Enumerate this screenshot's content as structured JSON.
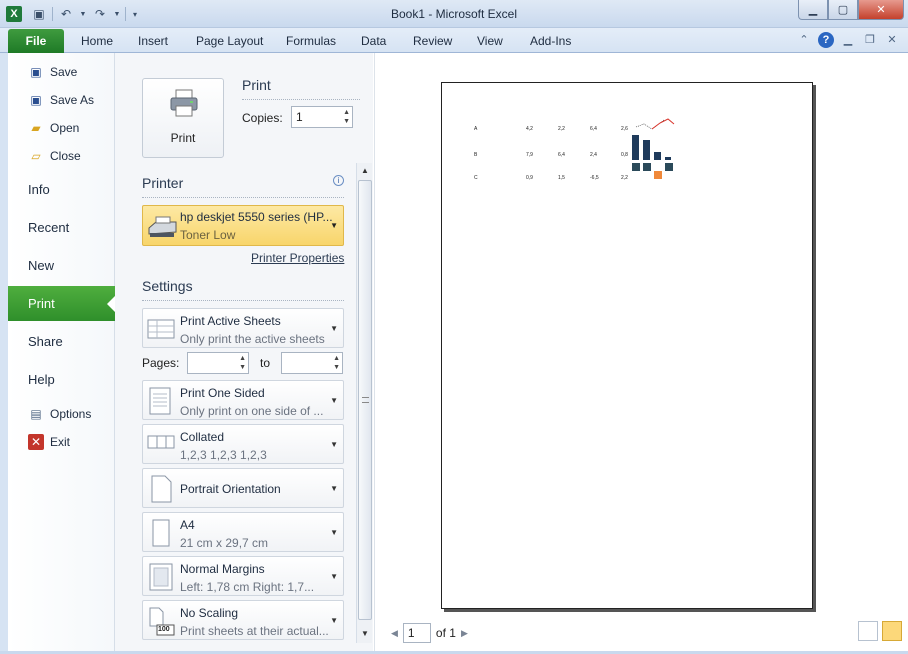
{
  "window": {
    "title": "Book1  -  Microsoft Excel",
    "app_letter": "X"
  },
  "ribbon": {
    "file_tab": "File",
    "tabs": [
      "Home",
      "Insert",
      "Page Layout",
      "Formulas",
      "Data",
      "Review",
      "View",
      "Add-Ins"
    ]
  },
  "nav": {
    "commands": [
      "Save",
      "Save As",
      "Open",
      "Close"
    ],
    "categories": [
      "Info",
      "Recent",
      "New",
      "Print",
      "Share",
      "Help"
    ],
    "bottom_commands": [
      "Options",
      "Exit"
    ]
  },
  "print_panel": {
    "heading": "Print",
    "button_label": "Print",
    "copies_label": "Copies:",
    "copies_value": "1",
    "printer_heading": "Printer",
    "printer_name": "hp deskjet 5550 series (HP...",
    "printer_status": "Toner Low",
    "printer_properties": "Printer Properties",
    "settings_heading": "Settings",
    "pages_label": "Pages:",
    "to_label": "to",
    "settings": [
      {
        "main": "Print Active Sheets",
        "sub": "Only print the active sheets"
      },
      {
        "main": "Print One Sided",
        "sub": "Only print on one side of ..."
      },
      {
        "main": "Collated",
        "sub": "1,2,3    1,2,3    1,2,3"
      },
      {
        "main": "Portrait Orientation",
        "sub": ""
      },
      {
        "main": "A4",
        "sub": "21 cm x 29,7 cm"
      },
      {
        "main": "Normal Margins",
        "sub": "Left:  1,78 cm    Right:  1,7..."
      },
      {
        "main": "No Scaling",
        "sub": "Print sheets at their actual..."
      }
    ],
    "scaling_badge": "100"
  },
  "preview": {
    "page_number": "1",
    "of_label": "of 1",
    "rows": [
      {
        "label": "A",
        "values": [
          "4,2",
          "2,2",
          "6,4",
          "2,6"
        ]
      },
      {
        "label": "B",
        "values": [
          "7,9",
          "6,4",
          "2,4",
          "0,8"
        ]
      },
      {
        "label": "C",
        "values": [
          "0,9",
          "1,5",
          "-6,5",
          "2,2"
        ]
      }
    ]
  },
  "colors": {
    "accent_green": "#2f8f2b",
    "printer_highlight": "#f8d56b",
    "bar_navy": "#1f3b5c",
    "negative_orange": "#f0893a",
    "sparkline_red": "#d9342b"
  }
}
